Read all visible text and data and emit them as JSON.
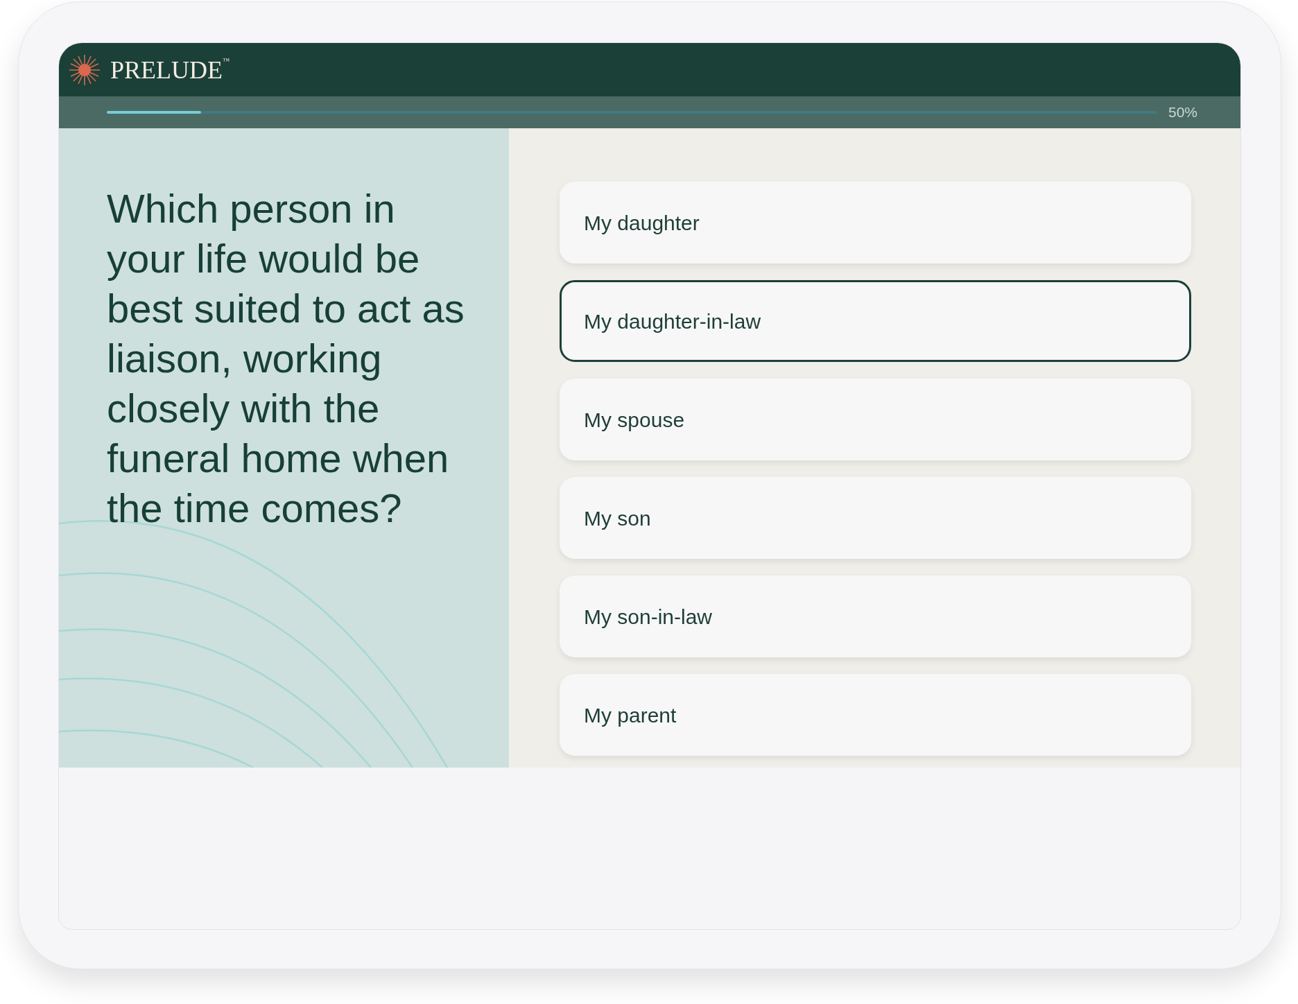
{
  "app": {
    "brand": "PRELUDE",
    "trademark": "™"
  },
  "progress": {
    "level": 0.09,
    "reading": "50%"
  },
  "question": "Which person in your life would be best suited to act as liaison, working closely with the funeral home when the time comes?",
  "options": [
    {
      "label": "My daughter",
      "selected": false
    },
    {
      "label": "My daughter-in-law",
      "selected": true
    },
    {
      "label": "My spouse",
      "selected": false
    },
    {
      "label": "My son",
      "selected": false
    },
    {
      "label": "My son-in-law",
      "selected": false
    },
    {
      "label": "My parent",
      "selected": false
    }
  ]
}
